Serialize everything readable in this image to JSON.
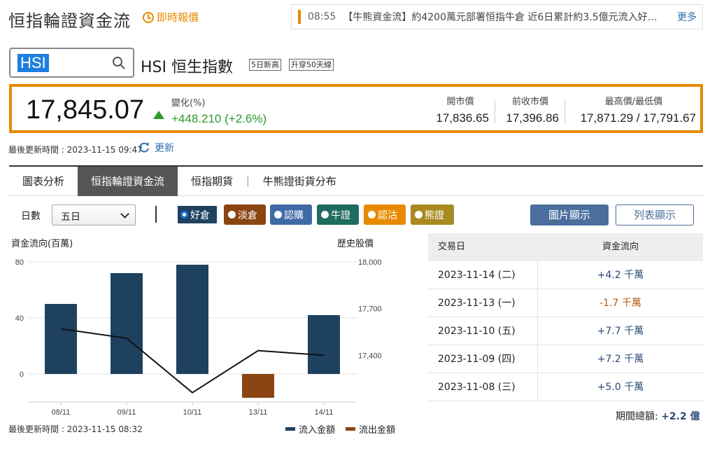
{
  "header": {
    "title": "恒指輪證資金流",
    "realtime_label": "即時報價",
    "ticker_time": "08:55",
    "ticker_text": "【牛熊資金流】約4200萬元部署恒指牛倉 近6日累計約3.5億元流入好…",
    "more_label": "更多"
  },
  "search": {
    "value": "HSI"
  },
  "stock": {
    "name": "HSI 恒生指數",
    "tags": [
      "5日新高",
      "升穿50天線"
    ]
  },
  "quote": {
    "price": "17,845.07",
    "change_label": "變化(%)",
    "change_value": "+448.210 (+2.6%)",
    "stats": [
      {
        "label": "開市價",
        "value": "17,836.65"
      },
      {
        "label": "前收市價",
        "value": "17,396.86"
      },
      {
        "label": "最高價/最低價",
        "value": "17,871.29 / 17,791.67"
      }
    ]
  },
  "update": {
    "text": "最後更新時間 : 2023-11-15 09:47",
    "refresh_label": "更新"
  },
  "tabs": [
    "圖表分析",
    "恒指輪證資金流",
    "恒指期貨",
    "牛熊證街貨分布"
  ],
  "active_tab": 1,
  "controls": {
    "days_label": "日數",
    "days_value": "五日",
    "filters": [
      {
        "label": "好倉",
        "color": "#1f4160",
        "checked": true
      },
      {
        "label": "淡倉",
        "color": "#8b4513",
        "checked": false
      },
      {
        "label": "認購",
        "color": "#3f6aa6",
        "checked": false
      },
      {
        "label": "牛證",
        "color": "#1e6b5f",
        "checked": false
      },
      {
        "label": "認沽",
        "color": "#e88a00",
        "checked": false
      },
      {
        "label": "熊證",
        "color": "#a88a20",
        "checked": false
      }
    ],
    "chart_view_label": "圖片顯示",
    "list_view_label": "列表顯示"
  },
  "chart_data": {
    "type": "bar",
    "ylabel_left": "資金流向(百萬)",
    "ylabel_right": "歷史股價",
    "categories": [
      "08/11",
      "09/11",
      "10/11",
      "13/11",
      "14/11"
    ],
    "left_ticks": [
      "80",
      "40",
      "0"
    ],
    "right_ticks": [
      "18,000",
      "17,700",
      "17,400"
    ],
    "ylim_left": [
      -20,
      80
    ],
    "ylim_right": [
      17100,
      18000
    ],
    "series": [
      {
        "name": "流入金額",
        "type": "bar",
        "color": "#1f4160",
        "values": [
          50,
          72,
          78,
          null,
          42
        ]
      },
      {
        "name": "流出金額",
        "type": "bar",
        "color": "#8b4513",
        "values": [
          null,
          null,
          null,
          -17,
          null
        ]
      },
      {
        "type": "line",
        "color": "#111111",
        "axis": "right",
        "values": [
          17570,
          17510,
          17160,
          17430,
          17400
        ]
      }
    ],
    "footer": "最後更新時間 : 2023-11-15 08:32"
  },
  "table": {
    "headers": [
      "交易日",
      "資金流向"
    ],
    "rows": [
      {
        "date": "2023-11-14 (二)",
        "flow": "+4.2 千萬",
        "color": "#2d4a7a"
      },
      {
        "date": "2023-11-13 (一)",
        "flow": "-1.7 千萬",
        "color": "#b05a10"
      },
      {
        "date": "2023-11-10 (五)",
        "flow": "+7.7 千萬",
        "color": "#2d4a7a"
      },
      {
        "date": "2023-11-09 (四)",
        "flow": "+7.2 千萬",
        "color": "#2d4a7a"
      },
      {
        "date": "2023-11-08 (三)",
        "flow": "+5.0 千萬",
        "color": "#2d4a7a"
      }
    ],
    "total_label": "期間總額:",
    "total_value": "+2.2 億"
  }
}
